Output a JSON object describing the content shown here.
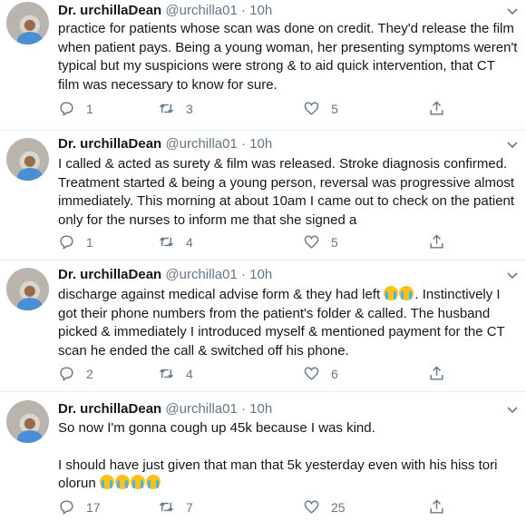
{
  "tweets": [
    {
      "name": "Dr. urchillaDean",
      "handle": "@urchilla01",
      "time": "10h",
      "lines": [
        "practice for patients whose scan was done on credit. They'd release the film",
        "when patient pays. Being a young woman, her presenting symptoms weren't",
        "typical but my suspicions were strong & to aid quick intervention, that CT",
        "film was necessary to know for sure."
      ],
      "replies": "1",
      "retweets": "3",
      "likes": "5"
    },
    {
      "name": "Dr. urchillaDean",
      "handle": "@urchilla01",
      "time": "10h",
      "lines": [
        "I called & acted as surety & film was released. Stroke diagnosis confirmed.",
        "Treatment started & being a young person, reversal was progressive almost",
        "immediately. This morning at about 10am I came out to check on the patient",
        "only for the nurses to inform me that she signed a"
      ],
      "replies": "1",
      "retweets": "4",
      "likes": "5"
    },
    {
      "name": "Dr. urchillaDean",
      "handle": "@urchilla01",
      "time": "10h",
      "lines": [
        "discharge against medical advise form & they had left",
        "Instinctively I",
        "got their phone numbers from the patient's folder & called. The husband",
        "picked & immediately I introduced myself & mentioned payment for the CT",
        "scan he ended the call & switched off his phone."
      ],
      "emoji": "loudly-crying-face x2",
      "replies": "2",
      "retweets": "4",
      "likes": "6"
    },
    {
      "name": "Dr. urchillaDean",
      "handle": "@urchilla01",
      "time": "10h",
      "lines": [
        "So now I'm gonna cough up 45k because I was kind.",
        "I should have just given that man that 5k yesterday even with his hiss tori",
        "olorun"
      ],
      "emoji": "loudly-crying-face x4",
      "replies": "17",
      "retweets": "7",
      "likes": "25"
    }
  ],
  "icons": [
    "reply-icon",
    "retweet-icon",
    "like-icon",
    "share-icon",
    "chevron-down-icon"
  ],
  "colors": {
    "text": "#14171a",
    "muted": "#657786",
    "divider": "#e6ecf0"
  }
}
